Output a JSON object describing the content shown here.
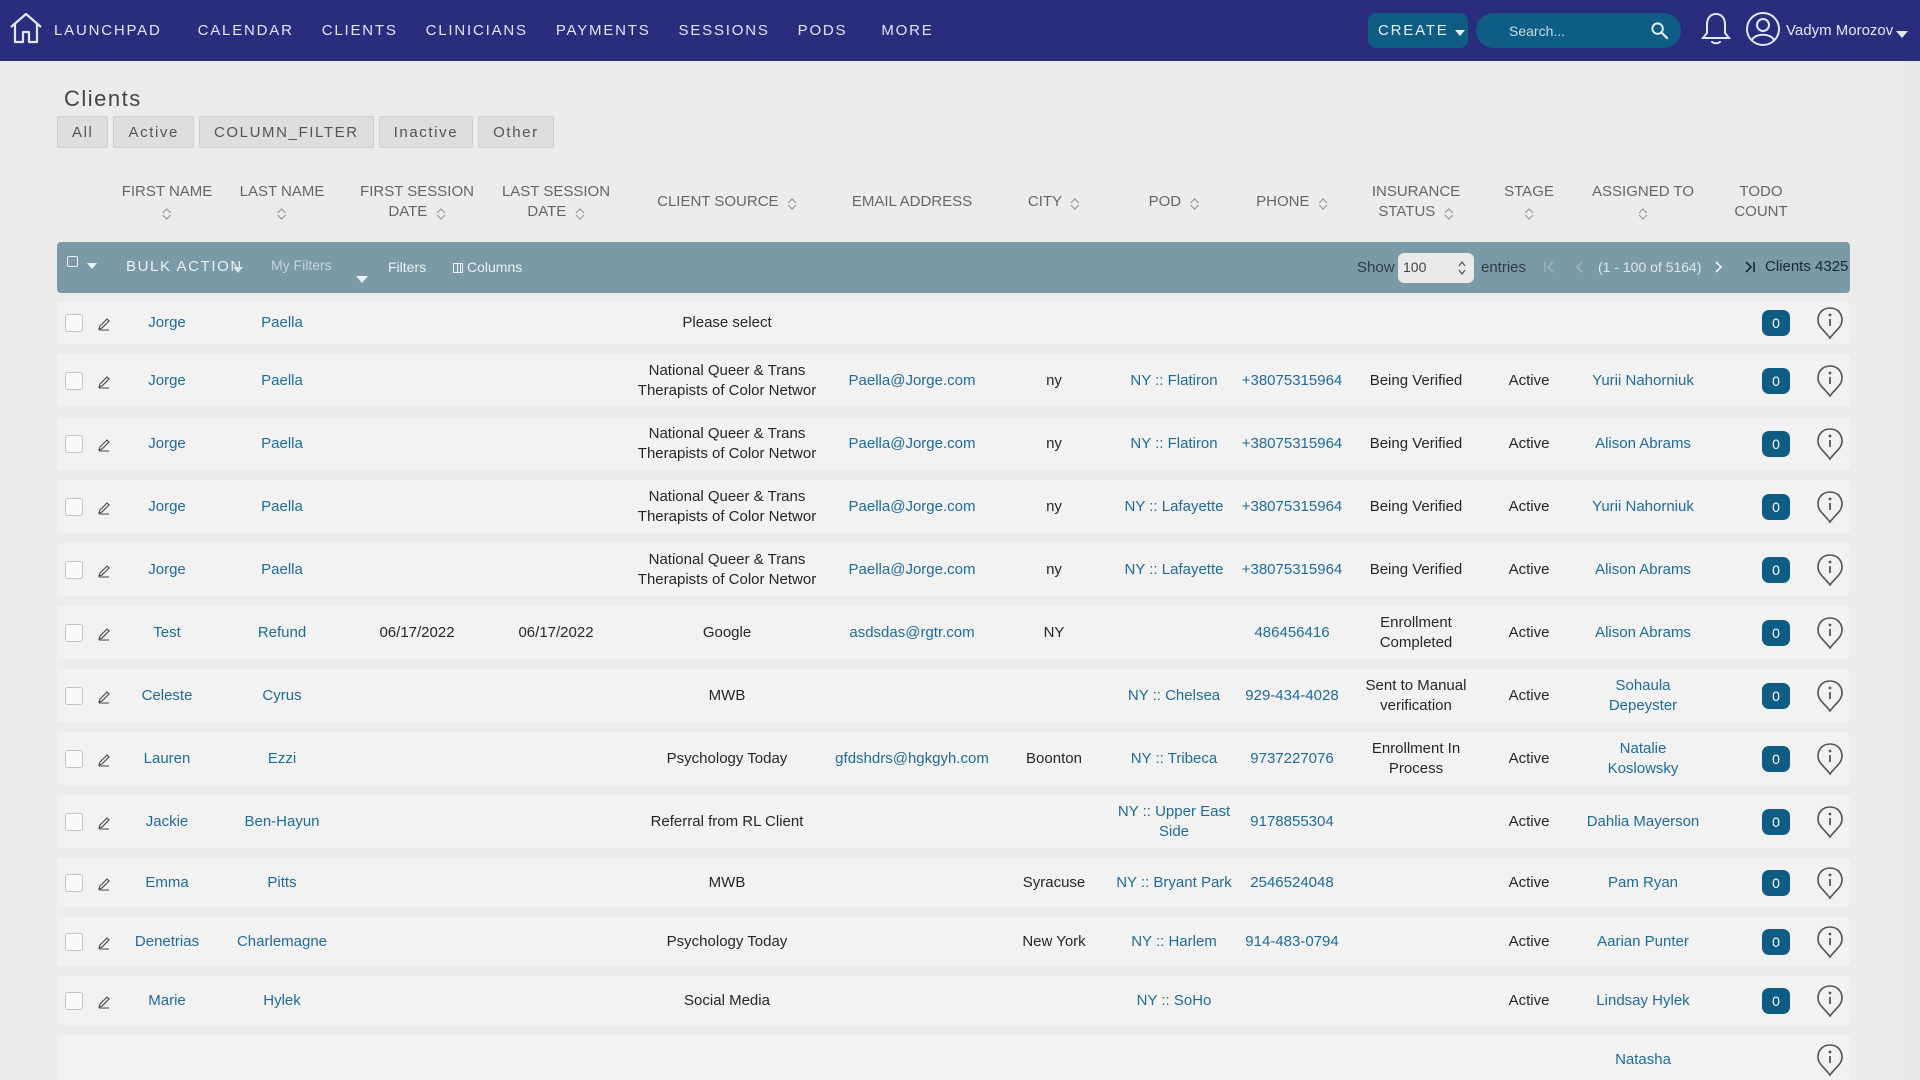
{
  "nav": {
    "links": [
      "LAUNCHPAD",
      "CALENDAR",
      "CLIENTS",
      "CLINICIANS",
      "PAYMENTS",
      "SESSIONS",
      "PODS",
      "MORE"
    ],
    "create_label": "CREATE",
    "search_placeholder": "Search...",
    "user_name": "Vadym Morozov",
    "icons": [
      "home-icon",
      "search-icon",
      "bell-icon",
      "user-avatar-icon",
      "chevron-down-icon"
    ]
  },
  "page": {
    "title": "Clients",
    "filter_tabs": [
      "All",
      "Active",
      "COLUMN_FILTER",
      "Inactive",
      "Other"
    ]
  },
  "columns": {
    "first_name": [
      "FIRST NAME"
    ],
    "last_name": [
      "LAST NAME"
    ],
    "first_session": [
      "FIRST SESSION",
      "DATE"
    ],
    "last_session": [
      "LAST SESSION",
      "DATE"
    ],
    "client_source": [
      "CLIENT SOURCE"
    ],
    "email": [
      "EMAIL ADDRESS"
    ],
    "city": [
      "CITY"
    ],
    "pod": [
      "POD"
    ],
    "phone": [
      "PHONE"
    ],
    "insurance": [
      "INSURANCE",
      "STATUS"
    ],
    "stage": [
      "STAGE"
    ],
    "assigned": [
      "ASSIGNED TO"
    ],
    "todo": [
      "TODO",
      "COUNT"
    ]
  },
  "toolbar": {
    "bulk_action": "BULK ACTION",
    "my_filters": "My Filters",
    "filters": "Filters",
    "columns": "Columns",
    "show": "Show",
    "show_value": "100",
    "entries": "entries",
    "range": "(1 - 100 of 5164)",
    "clients_count": "Clients 4325"
  },
  "rows": [
    {
      "first": "Jorge",
      "last": "Paella",
      "first_session": "",
      "last_session": "",
      "source": [
        "Please select"
      ],
      "email": "",
      "city": "",
      "pod": [],
      "phone": "",
      "insurance": [],
      "stage": "",
      "assigned": [],
      "todo": "0"
    },
    {
      "first": "Jorge",
      "last": "Paella",
      "first_session": "",
      "last_session": "",
      "source": [
        "National Queer & Trans",
        "Therapists of Color Networ"
      ],
      "email": "Paella@Jorge.com",
      "city": "ny",
      "pod": [
        "NY :: Flatiron"
      ],
      "phone": "+38075315964",
      "insurance": [
        "Being Verified"
      ],
      "stage": "Active",
      "assigned": [
        "Yurii Nahorniuk"
      ],
      "todo": "0"
    },
    {
      "first": "Jorge",
      "last": "Paella",
      "first_session": "",
      "last_session": "",
      "source": [
        "National Queer & Trans",
        "Therapists of Color Networ"
      ],
      "email": "Paella@Jorge.com",
      "city": "ny",
      "pod": [
        "NY :: Flatiron"
      ],
      "phone": "+38075315964",
      "insurance": [
        "Being Verified"
      ],
      "stage": "Active",
      "assigned": [
        "Alison Abrams"
      ],
      "todo": "0"
    },
    {
      "first": "Jorge",
      "last": "Paella",
      "first_session": "",
      "last_session": "",
      "source": [
        "National Queer & Trans",
        "Therapists of Color Networ"
      ],
      "email": "Paella@Jorge.com",
      "city": "ny",
      "pod": [
        "NY :: Lafayette"
      ],
      "phone": "+38075315964",
      "insurance": [
        "Being Verified"
      ],
      "stage": "Active",
      "assigned": [
        "Yurii Nahorniuk"
      ],
      "todo": "0"
    },
    {
      "first": "Jorge",
      "last": "Paella",
      "first_session": "",
      "last_session": "",
      "source": [
        "National Queer & Trans",
        "Therapists of Color Networ"
      ],
      "email": "Paella@Jorge.com",
      "city": "ny",
      "pod": [
        "NY :: Lafayette"
      ],
      "phone": "+38075315964",
      "insurance": [
        "Being Verified"
      ],
      "stage": "Active",
      "assigned": [
        "Alison Abrams"
      ],
      "todo": "0"
    },
    {
      "first": "Test",
      "last": "Refund",
      "first_session": "06/17/2022",
      "last_session": "06/17/2022",
      "source": [
        "Google"
      ],
      "email": "asdsdas@rgtr.com",
      "city": "NY",
      "pod": [],
      "phone": "486456416",
      "insurance": [
        "Enrollment",
        "Completed"
      ],
      "stage": "Active",
      "assigned": [
        "Alison Abrams"
      ],
      "todo": "0"
    },
    {
      "first": "Celeste",
      "last": "Cyrus",
      "first_session": "",
      "last_session": "",
      "source": [
        "MWB"
      ],
      "email": "",
      "city": "",
      "pod": [
        "NY :: Chelsea"
      ],
      "phone": "929-434-4028",
      "insurance": [
        "Sent to Manual",
        "verification"
      ],
      "stage": "Active",
      "assigned": [
        "Sohaula",
        "Depeyster"
      ],
      "todo": "0"
    },
    {
      "first": "Lauren",
      "last": "Ezzi",
      "first_session": "",
      "last_session": "",
      "source": [
        "Psychology Today"
      ],
      "email": "gfdshdrs@hgkgyh.com",
      "city": "Boonton",
      "pod": [
        "NY :: Tribeca"
      ],
      "phone": "9737227076",
      "insurance": [
        "Enrollment In",
        "Process"
      ],
      "stage": "Active",
      "assigned": [
        "Natalie",
        "Koslowsky"
      ],
      "todo": "0"
    },
    {
      "first": "Jackie",
      "last": "Ben-Hayun",
      "first_session": "",
      "last_session": "",
      "source": [
        "Referral from RL Client"
      ],
      "email": "",
      "city": "",
      "pod": [
        "NY :: Upper East",
        "Side"
      ],
      "phone": "9178855304",
      "insurance": [],
      "stage": "Active",
      "assigned": [
        "Dahlia Mayerson"
      ],
      "todo": "0"
    },
    {
      "first": "Emma",
      "last": "Pitts",
      "first_session": "",
      "last_session": "",
      "source": [
        "MWB"
      ],
      "email": "",
      "city": "Syracuse",
      "pod": [
        "NY :: Bryant Park"
      ],
      "phone": "2546524048",
      "insurance": [],
      "stage": "Active",
      "assigned": [
        "Pam Ryan"
      ],
      "todo": "0"
    },
    {
      "first": "Denetrias",
      "last": "Charlemagne",
      "first_session": "",
      "last_session": "",
      "source": [
        "Psychology Today"
      ],
      "email": "",
      "city": "New York",
      "pod": [
        "NY :: Harlem"
      ],
      "phone": "914-483-0794",
      "insurance": [],
      "stage": "Active",
      "assigned": [
        "Aarian Punter"
      ],
      "todo": "0"
    },
    {
      "first": "Marie",
      "last": "Hylek",
      "first_session": "",
      "last_session": "",
      "source": [
        "Social Media"
      ],
      "email": "",
      "city": "",
      "pod": [
        "NY :: SoHo"
      ],
      "phone": "",
      "insurance": [],
      "stage": "Active",
      "assigned": [
        "Lindsay Hylek"
      ],
      "todo": "0"
    },
    {
      "first": "",
      "last": "",
      "first_session": "",
      "last_session": "",
      "source": [],
      "email": "",
      "city": "",
      "pod": [],
      "phone": "",
      "insurance": [],
      "stage": "",
      "assigned": [
        "Natasha"
      ],
      "todo": ""
    }
  ],
  "colors": {
    "navbar": "#2a2d7e",
    "accent": "#0f5c85",
    "toolbar": "#7a9aa8",
    "link": "#1f6b9a",
    "row_bg": "#f2f2f2",
    "page_bg": "#ececec"
  }
}
